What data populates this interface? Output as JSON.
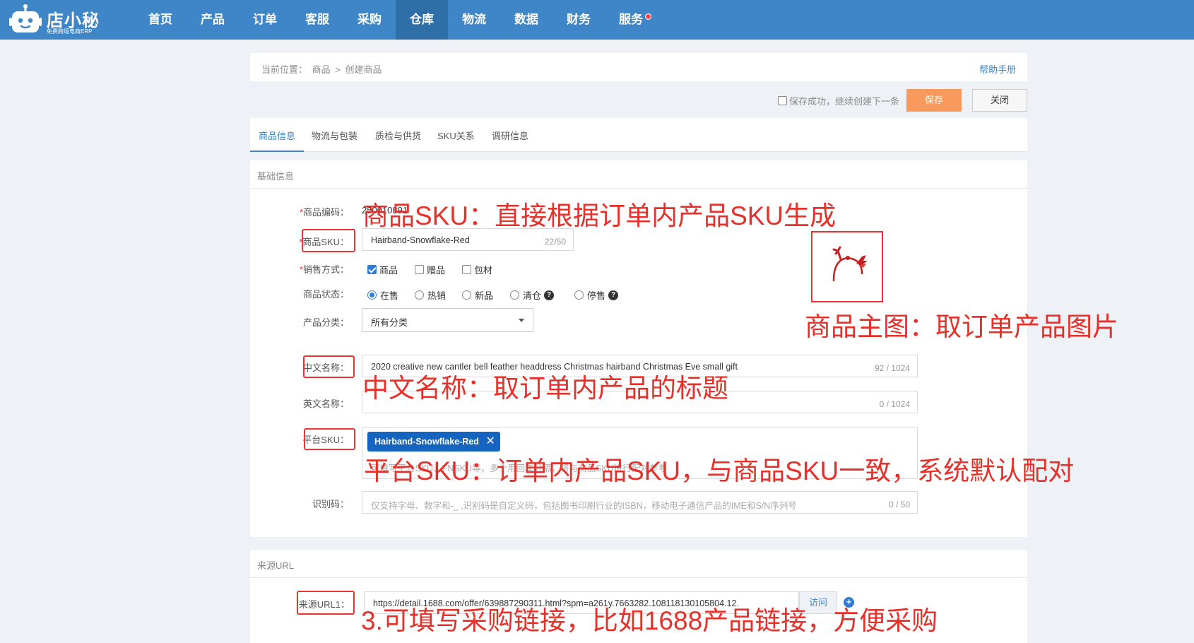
{
  "app": {
    "logo_name": "店小秘",
    "logo_sub": "免费跨境电商ERP"
  },
  "nav": {
    "items": [
      "首页",
      "产品",
      "订单",
      "客服",
      "采购",
      "仓库",
      "物流",
      "数据",
      "财务",
      "服务"
    ],
    "active_index": 5
  },
  "breadcrumb": {
    "prefix": "当前位置：",
    "parent": "商品",
    "separator": ">",
    "current": "创建商品"
  },
  "help_link": "帮助手册",
  "actions": {
    "continue_label": "保存成功，继续创建下一条",
    "save_label": "保存",
    "close_label": "关闭"
  },
  "tabs": [
    "商品信息",
    "物流与包装",
    "质检与供货",
    "SKU关系",
    "调研信息"
  ],
  "basic": {
    "section_title": "基础信息",
    "code_label": "商品编码：",
    "code_value": "250010891",
    "sku_label": "商品SKU：",
    "sku_value": "Hairband-Snowflake-Red",
    "sku_count": "22/50",
    "sale_mode_label": "销售方式：",
    "sale_modes": [
      "商品",
      "赠品",
      "包材"
    ],
    "status_label": "商品状态：",
    "statuses": [
      "在售",
      "热销",
      "新品",
      "清仓",
      "停售"
    ],
    "category_label": "产品分类：",
    "category_value": "所有分类",
    "cn_name_label": "中文名称：",
    "cn_name_value": "2020 creative new cantler bell feather headdress Christmas hairband Christmas Eve small gift",
    "cn_name_count": "92 / 1024",
    "en_name_label": "英文名称：",
    "en_name_count": "0 / 1024",
    "platform_sku_label": "平台SKU：",
    "platform_sku_tag": "Hairband-Snowflake-Red",
    "platform_sku_placeholder": "可填写平台SKU、FNSKU等，多个用回车分隔，将与商品SKU进行配对参考",
    "id_code_label": "识别码：",
    "id_code_placeholder": "仅支持字母、数字和-_ ,识别码是自定义码，包括图书印刷行业的ISBN，移动电子通信产品的IME和S/N序列号",
    "id_code_count": "0 / 50"
  },
  "source": {
    "section_title": "来源URL",
    "url_label": "来源URL1：",
    "url_value": "https://detail.1688.com/offer/639887290311.html?spm=a261y.7663282.108118130105804.12.",
    "visit_label": "访问"
  },
  "annotations": {
    "sku_note": "商品SKU：直接根据订单内产品SKU生成",
    "image_note": "商品主图：取订单产品图片",
    "cn_name_note": "中文名称：取订单内产品的标题",
    "platform_sku_note": "平台SKU：订单内产品SKU，与商品SKU一致，系统默认配对",
    "url_note": "3.可填写采购链接，比如1688产品链接，方便采购"
  },
  "colors": {
    "topbar": "#3e86c7",
    "accent": "#2f7bd6",
    "save_button": "#f89a5d",
    "annotation": "#e8302a",
    "tag": "#1565c0"
  }
}
